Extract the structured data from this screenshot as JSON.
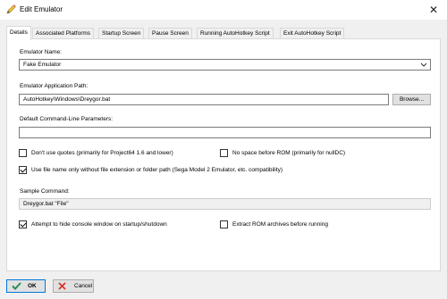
{
  "window": {
    "title": "Edit Emulator",
    "close_glyph": "✕"
  },
  "tabs": [
    {
      "label": "Details",
      "active": true
    },
    {
      "label": "Associated Platforms",
      "active": false
    },
    {
      "label": "Startup Screen",
      "active": false
    },
    {
      "label": "Pause Screen",
      "active": false
    },
    {
      "label": "Running AutoHotkey Script",
      "active": false
    },
    {
      "label": "Exit AutoHotkey Script",
      "active": false
    }
  ],
  "form": {
    "emulator_name_label": "Emulator Name:",
    "emulator_name_value": "Fake Emulator",
    "app_path_label": "Emulator Application Path:",
    "app_path_value": "AutoHotkey\\Windows\\Dreygor.bat",
    "browse_label": "Browse...",
    "cmdline_label": "Default Command-Line Parameters:",
    "cmdline_value": "",
    "dont_use_quotes_label": "Don't use quotes (primarily for Project64 1.6 and lower)",
    "dont_use_quotes_checked": false,
    "no_space_label": "No space before ROM (primarily for nullDC)",
    "no_space_checked": false,
    "use_filename_label": "Use file name only without file extension or folder path (Sega Model 2 Emulator, etc. compatibility)",
    "use_filename_checked": true,
    "sample_label": "Sample Command:",
    "sample_value": "Dreygor.bat \"File\"",
    "hide_console_label": "Attempt to hide console window on startup/shutdown",
    "hide_console_checked": true,
    "extract_rom_label": "Extract ROM archives before running",
    "extract_rom_checked": false
  },
  "footer": {
    "ok_label": "OK",
    "cancel_label": "Cancel"
  },
  "colors": {
    "ok_icon": "#2e8b57",
    "cancel_icon": "#d9342b",
    "accent": "#0078d7"
  }
}
